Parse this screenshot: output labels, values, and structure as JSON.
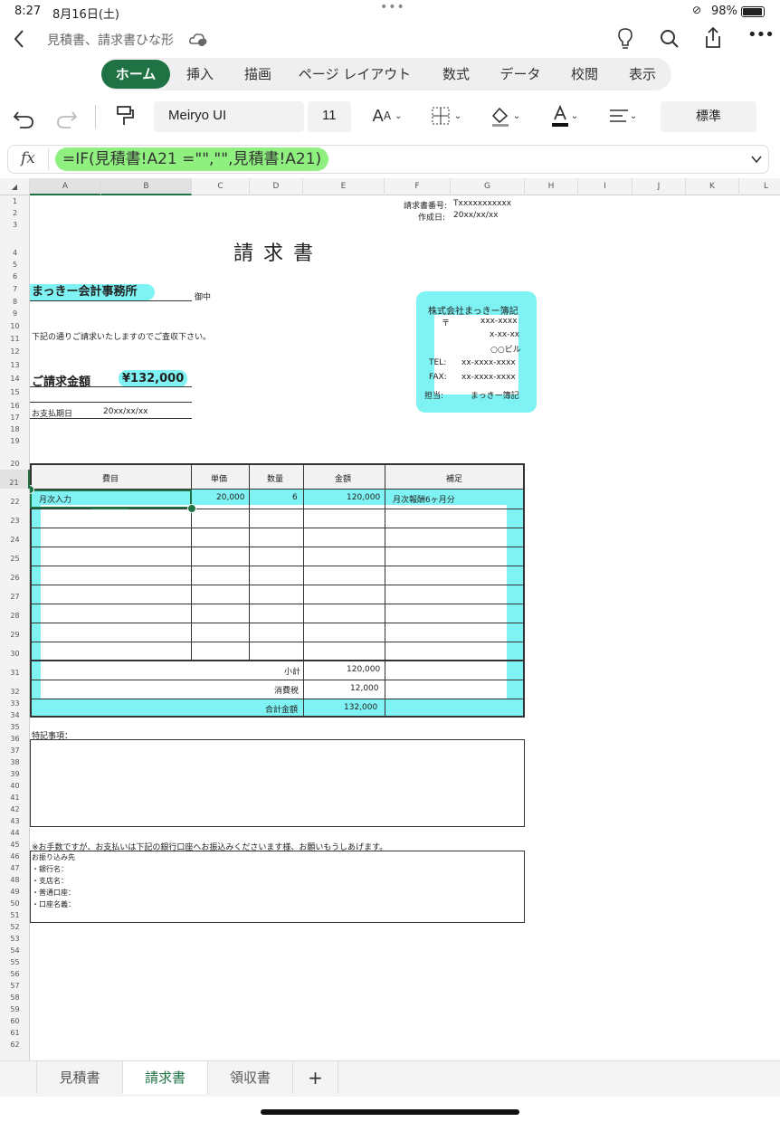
{
  "status": {
    "time": "8:27",
    "date": "8月16日(土)",
    "battery": "98%"
  },
  "title": {
    "filename": "見積書、請求書ひな形"
  },
  "ribbon": {
    "tabs": [
      "ホーム",
      "挿入",
      "描画",
      "ページ レイアウト",
      "数式",
      "データ",
      "校閲",
      "表示"
    ]
  },
  "toolbar": {
    "font": "Meiryo UI",
    "size": "11",
    "format": "標準"
  },
  "formula": {
    "fx": "fx",
    "text": "=IF(見積書!A21 =\"\",\"\",見積書!A21)"
  },
  "columns": [
    "A",
    "B",
    "C",
    "D",
    "E",
    "F",
    "G",
    "H",
    "I",
    "J",
    "K",
    "L"
  ],
  "rows": [
    "1",
    "2",
    "3",
    "4",
    "5",
    "6",
    "7",
    "8",
    "9",
    "10",
    "11",
    "12",
    "13",
    "14",
    "15",
    "16",
    "17",
    "18",
    "19",
    "20",
    "21",
    "22",
    "23",
    "24",
    "25",
    "26",
    "27",
    "28",
    "29",
    "30",
    "31",
    "32",
    "33",
    "34",
    "35",
    "36",
    "37",
    "38",
    "39",
    "40",
    "41",
    "42",
    "43",
    "44",
    "45",
    "46",
    "47",
    "48",
    "49",
    "50",
    "51",
    "52",
    "53",
    "54",
    "55",
    "56",
    "57",
    "58",
    "59",
    "60",
    "61",
    "62"
  ],
  "doc": {
    "inv_no_label": "請求書番号:",
    "inv_no": "Txxxxxxxxxxx",
    "date_label": "作成日:",
    "date": "20xx/xx/xx",
    "title": "請 求 書",
    "client": "まっきー会計事務所",
    "onchu": "御中",
    "intro": "下記の通りご請求いたしますのでご査収下さい。",
    "amount_label": "ご請求金額",
    "amount": "¥132,000",
    "due_label": "お支払期日",
    "due": "20xx/xx/xx",
    "company": "株式会社まっきー簿記",
    "postal": "〒",
    "postal_code": "xxx-xxxx",
    "addr1": "x-xx-xx",
    "addr2": "○○ビル",
    "tel_label": "TEL:",
    "tel": "xx-xxxx-xxxx",
    "fax_label": "FAX:",
    "fax": "xx-xxxx-xxxx",
    "rep_label": "担当:",
    "rep": "まっきー簿記",
    "th_item": "費目",
    "th_price": "単価",
    "th_qty": "数量",
    "th_amount": "金額",
    "th_note": "補足",
    "r21_item": "月次入力",
    "r21_price": "20,000",
    "r21_qty": "6",
    "r21_amount": "120,000",
    "r21_note": "月次報酬6ヶ月分",
    "subtotal_label": "小計",
    "subtotal": "120,000",
    "tax_label": "消費税",
    "tax": "12,000",
    "total_label": "合計金額",
    "total": "132,000",
    "remarks": "特記事項：",
    "pay_note": "※お手数ですが、お支払いは下記の銀行口座へお振込みくださいます様、お願いもうしあげます。",
    "bank_title": "お振り込み先",
    "bank1": "・銀行名：",
    "bank2": "・支店名：",
    "bank3": "・普通口座：",
    "bank4": "・口座名義："
  },
  "sheets": [
    "見積書",
    "請求書",
    "領収書"
  ],
  "add_sheet": "+",
  "colors": {
    "accent": "#1f7244",
    "highlight": "#7ff3f3",
    "formula_hl": "#8ff07f"
  }
}
